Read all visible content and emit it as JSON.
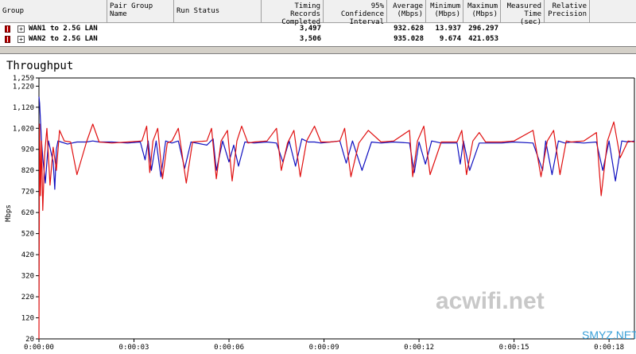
{
  "table": {
    "headers": {
      "group": "Group",
      "pair_group_name": "Pair Group\nName",
      "run_status": "Run Status",
      "timing_records": "Timing Records\nCompleted",
      "confidence": "95% Confidence\nInterval",
      "average": "Average\n(Mbps)",
      "minimum": "Minimum\n(Mbps)",
      "maximum": "Maximum\n(Mbps)",
      "measured_time": "Measured\nTime (sec)",
      "relative_precision": "Relative\nPrecision"
    },
    "rows": [
      {
        "expand": "+",
        "group": "WAN1 to 2.5G LAN",
        "pair_group_name": "",
        "run_status": "",
        "timing_records": "3,497",
        "confidence": "",
        "average": "932.628",
        "minimum": "13.937",
        "maximum": "296.297",
        "measured_time": "",
        "relative_precision": ""
      },
      {
        "expand": "+",
        "group": "WAN2 to 2.5G LAN",
        "pair_group_name": "",
        "run_status": "",
        "timing_records": "3,506",
        "confidence": "",
        "average": "935.028",
        "minimum": "9.674",
        "maximum": "421.053",
        "measured_time": "",
        "relative_precision": ""
      }
    ]
  },
  "chart_data": {
    "type": "line",
    "title": "Throughput",
    "ylabel": "Mbps",
    "xlabel": "",
    "ylim": [
      20,
      1259
    ],
    "y_ticks": [
      "1,259",
      "1,220",
      "1,120",
      "1,020",
      "920",
      "820",
      "720",
      "620",
      "520",
      "420",
      "320",
      "220",
      "120",
      "20"
    ],
    "y_tick_values": [
      1259,
      1220,
      1120,
      1020,
      920,
      820,
      720,
      620,
      520,
      420,
      320,
      220,
      120,
      20
    ],
    "x_ticks": [
      "0:00:00",
      "0:00:03",
      "0:00:06",
      "0:00:09",
      "0:00:12",
      "0:00:15",
      "0:00:18"
    ],
    "x_tick_values": [
      0,
      3,
      6,
      9,
      12,
      15,
      18
    ],
    "xlim": [
      0,
      18.8
    ],
    "grid": true,
    "series": [
      {
        "color": "#1010c0",
        "x": [
          0,
          0.02,
          0.05,
          0.08,
          0.12,
          0.2,
          0.3,
          0.45,
          0.5,
          0.55,
          0.6,
          0.7,
          0.9,
          1.2,
          1.5,
          1.7,
          1.9,
          2.3,
          2.8,
          3.2,
          3.35,
          3.45,
          3.55,
          3.7,
          3.85,
          4.0,
          4.2,
          4.4,
          4.6,
          4.8,
          5.3,
          5.5,
          5.6,
          5.8,
          6.0,
          6.15,
          6.3,
          6.5,
          6.8,
          7.2,
          7.5,
          7.7,
          7.9,
          8.1,
          8.3,
          8.5,
          8.7,
          8.9,
          9.2,
          9.5,
          9.7,
          9.9,
          10.2,
          10.5,
          10.8,
          11.2,
          11.7,
          11.85,
          12.0,
          12.2,
          12.4,
          12.7,
          13.2,
          13.3,
          13.4,
          13.6,
          13.9,
          14.1,
          14.3,
          14.6,
          15.0,
          15.6,
          15.9,
          16.0,
          16.2,
          16.4,
          16.6,
          16.8,
          17.2,
          17.6,
          17.8,
          18.0,
          18.2,
          18.4,
          18.6,
          18.8
        ],
        "values": [
          1170,
          1140,
          1050,
          960,
          880,
          760,
          960,
          860,
          730,
          920,
          960,
          955,
          945,
          955,
          955,
          960,
          955,
          955,
          950,
          955,
          870,
          960,
          820,
          960,
          790,
          960,
          950,
          960,
          830,
          955,
          940,
          970,
          820,
          960,
          860,
          940,
          840,
          955,
          950,
          955,
          950,
          860,
          960,
          840,
          970,
          955,
          955,
          950,
          955,
          960,
          855,
          960,
          820,
          955,
          950,
          955,
          950,
          810,
          955,
          850,
          960,
          950,
          950,
          850,
          960,
          820,
          950,
          950,
          950,
          950,
          955,
          950,
          820,
          960,
          800,
          960,
          950,
          955,
          950,
          955,
          820,
          960,
          770,
          960,
          955,
          960
        ]
      },
      {
        "color": "#e01010",
        "x": [
          0,
          0.02,
          0.05,
          0.08,
          0.12,
          0.18,
          0.25,
          0.35,
          0.45,
          0.55,
          0.65,
          0.8,
          1.0,
          1.2,
          1.5,
          1.7,
          1.9,
          2.3,
          2.8,
          3.25,
          3.4,
          3.5,
          3.6,
          3.75,
          3.9,
          4.05,
          4.2,
          4.4,
          4.65,
          4.85,
          5.3,
          5.45,
          5.6,
          5.75,
          5.95,
          6.1,
          6.25,
          6.4,
          6.6,
          6.8,
          7.2,
          7.5,
          7.65,
          7.85,
          8.05,
          8.25,
          8.45,
          8.7,
          8.9,
          9.2,
          9.5,
          9.65,
          9.85,
          10.1,
          10.4,
          10.8,
          11.2,
          11.7,
          11.8,
          11.95,
          12.15,
          12.35,
          12.7,
          13.2,
          13.35,
          13.5,
          13.7,
          13.9,
          14.1,
          14.3,
          14.6,
          15.0,
          15.6,
          15.85,
          16.05,
          16.25,
          16.45,
          16.65,
          16.8,
          17.2,
          17.6,
          17.75,
          17.95,
          18.15,
          18.35,
          18.6,
          18.8
        ],
        "values": [
          20,
          1040,
          700,
          960,
          630,
          900,
          1020,
          750,
          930,
          820,
          1010,
          960,
          955,
          800,
          955,
          1040,
          955,
          950,
          955,
          960,
          1030,
          810,
          960,
          1020,
          780,
          950,
          960,
          1020,
          760,
          955,
          960,
          1020,
          780,
          960,
          1010,
          770,
          960,
          1030,
          950,
          955,
          960,
          1020,
          820,
          950,
          1010,
          790,
          960,
          1030,
          955,
          955,
          960,
          1020,
          790,
          950,
          1010,
          955,
          960,
          1010,
          790,
          960,
          1030,
          800,
          955,
          955,
          1010,
          800,
          960,
          1000,
          955,
          955,
          955,
          960,
          1010,
          790,
          960,
          1010,
          800,
          960,
          955,
          960,
          1000,
          700,
          960,
          1050,
          880,
          960,
          955
        ]
      }
    ]
  },
  "watermark": {
    "text": "acwifi.net",
    "corner": "SMYZ.NET"
  }
}
